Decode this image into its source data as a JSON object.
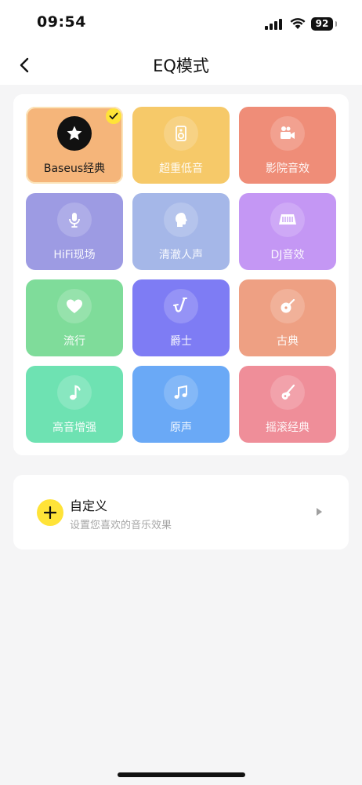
{
  "status_bar": {
    "time": "09:54",
    "battery": "92"
  },
  "nav": {
    "title": "EQ模式"
  },
  "presets": [
    {
      "label": "Baseus经典",
      "icon": "star-icon",
      "color": "#f5b57a",
      "selected": true
    },
    {
      "label": "超重低音",
      "icon": "speaker-icon",
      "color": "#f6c969",
      "selected": false
    },
    {
      "label": "影院音效",
      "icon": "video-camera-icon",
      "color": "#ef8d78",
      "selected": false
    },
    {
      "label": "HiFi现场",
      "icon": "microphone-icon",
      "color": "#9d9be3",
      "selected": false
    },
    {
      "label": "清澈人声",
      "icon": "head-icon",
      "color": "#a5b7e8",
      "selected": false
    },
    {
      "label": "DJ音效",
      "icon": "dj-deck-icon",
      "color": "#c497f4",
      "selected": false
    },
    {
      "label": "流行",
      "icon": "heart-icon",
      "color": "#7fdc9a",
      "selected": false
    },
    {
      "label": "爵士",
      "icon": "saxophone-icon",
      "color": "#7e7cf4",
      "selected": false
    },
    {
      "label": "古典",
      "icon": "lute-icon",
      "color": "#eea083",
      "selected": false
    },
    {
      "label": "高音增强",
      "icon": "music-note-icon",
      "color": "#6ee2b2",
      "selected": false
    },
    {
      "label": "原声",
      "icon": "music-notes-icon",
      "color": "#6aa9f6",
      "selected": false
    },
    {
      "label": "摇滚经典",
      "icon": "electric-guitar-icon",
      "color": "#ef8e99",
      "selected": false
    }
  ],
  "custom": {
    "title": "自定义",
    "subtitle": "设置您喜欢的音乐效果"
  }
}
